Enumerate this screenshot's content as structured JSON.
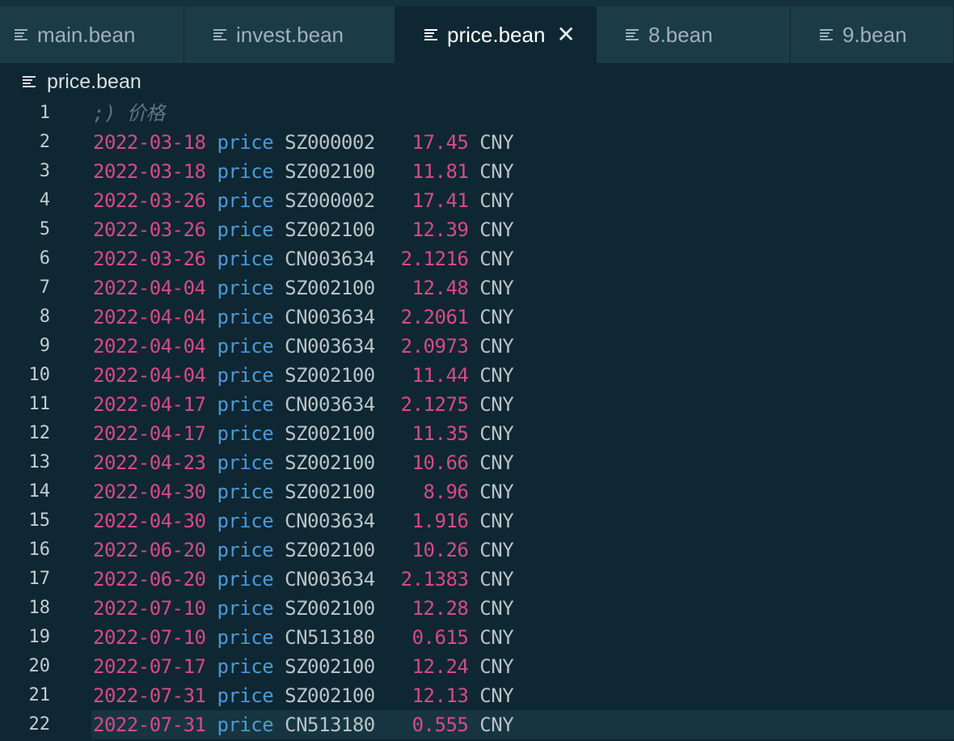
{
  "tabs": [
    {
      "label": "main.bean",
      "active": false,
      "width": 228,
      "pad": 18
    },
    {
      "label": "invest.bean",
      "active": false,
      "width": 261,
      "pad": 36
    },
    {
      "label": "price.bean",
      "active": true,
      "width": 249,
      "pad": 36
    },
    {
      "label": "8.bean",
      "active": false,
      "width": 240,
      "pad": 36
    },
    {
      "label": "9.bean",
      "active": false,
      "width": 202,
      "pad": 36
    }
  ],
  "breadcrumb": {
    "file": "price.bean"
  },
  "editor": {
    "comment": ";) 价格",
    "current_line": 22,
    "rows": [
      {
        "date": "2022-03-18",
        "kw": "price",
        "sym": "SZ000002",
        "num": "17.45",
        "cur": "CNY"
      },
      {
        "date": "2022-03-18",
        "kw": "price",
        "sym": "SZ002100",
        "num": "11.81",
        "cur": "CNY"
      },
      {
        "date": "2022-03-26",
        "kw": "price",
        "sym": "SZ000002",
        "num": "17.41",
        "cur": "CNY"
      },
      {
        "date": "2022-03-26",
        "kw": "price",
        "sym": "SZ002100",
        "num": "12.39",
        "cur": "CNY"
      },
      {
        "date": "2022-03-26",
        "kw": "price",
        "sym": "CN003634",
        "num": "2.1216",
        "cur": "CNY"
      },
      {
        "date": "2022-04-04",
        "kw": "price",
        "sym": "SZ002100",
        "num": "12.48",
        "cur": "CNY"
      },
      {
        "date": "2022-04-04",
        "kw": "price",
        "sym": "CN003634",
        "num": "2.2061",
        "cur": "CNY"
      },
      {
        "date": "2022-04-04",
        "kw": "price",
        "sym": "CN003634",
        "num": "2.0973",
        "cur": "CNY"
      },
      {
        "date": "2022-04-04",
        "kw": "price",
        "sym": "SZ002100",
        "num": "11.44",
        "cur": "CNY"
      },
      {
        "date": "2022-04-17",
        "kw": "price",
        "sym": "CN003634",
        "num": "2.1275",
        "cur": "CNY"
      },
      {
        "date": "2022-04-17",
        "kw": "price",
        "sym": "SZ002100",
        "num": "11.35",
        "cur": "CNY"
      },
      {
        "date": "2022-04-23",
        "kw": "price",
        "sym": "SZ002100",
        "num": "10.66",
        "cur": "CNY"
      },
      {
        "date": "2022-04-30",
        "kw": "price",
        "sym": "SZ002100",
        "num": "8.96",
        "cur": "CNY"
      },
      {
        "date": "2022-04-30",
        "kw": "price",
        "sym": "CN003634",
        "num": "1.916",
        "cur": "CNY"
      },
      {
        "date": "2022-06-20",
        "kw": "price",
        "sym": "SZ002100",
        "num": "10.26",
        "cur": "CNY"
      },
      {
        "date": "2022-06-20",
        "kw": "price",
        "sym": "CN003634",
        "num": "2.1383",
        "cur": "CNY"
      },
      {
        "date": "2022-07-10",
        "kw": "price",
        "sym": "SZ002100",
        "num": "12.28",
        "cur": "CNY"
      },
      {
        "date": "2022-07-10",
        "kw": "price",
        "sym": "CN513180",
        "num": "0.615",
        "cur": "CNY"
      },
      {
        "date": "2022-07-17",
        "kw": "price",
        "sym": "SZ002100",
        "num": "12.24",
        "cur": "CNY"
      },
      {
        "date": "2022-07-31",
        "kw": "price",
        "sym": "SZ002100",
        "num": "12.13",
        "cur": "CNY"
      },
      {
        "date": "2022-07-31",
        "kw": "price",
        "sym": "CN513180",
        "num": "0.555",
        "cur": "CNY"
      }
    ]
  },
  "colors": {
    "background": "#0f2732",
    "tab_inactive": "#1b3b47",
    "date": "#d64b86",
    "keyword": "#4b9ad8",
    "symbol": "#b9c4c8",
    "comment": "#5d7582"
  },
  "icons": {
    "tab_file": "file-lines-icon",
    "tab_close": "close-icon"
  }
}
